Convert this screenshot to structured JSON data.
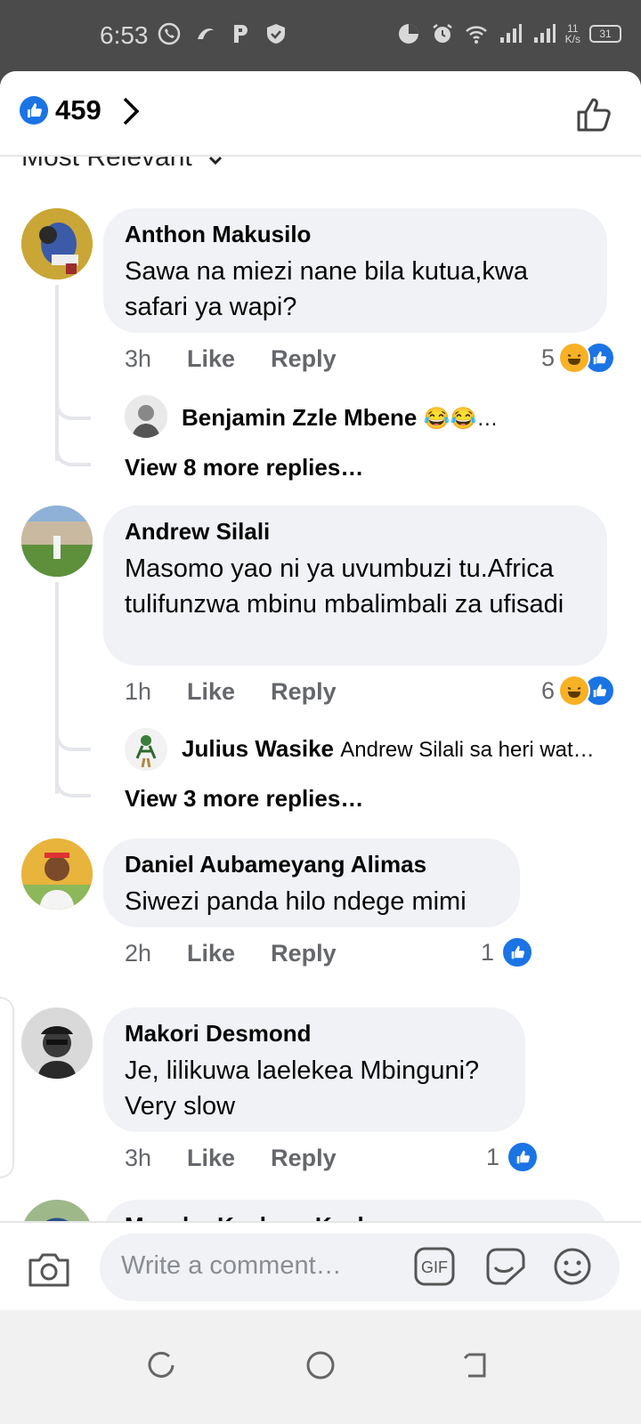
{
  "status_bar": {
    "time": "6:53",
    "net_speed_top": "11",
    "net_speed_unit": "K/s",
    "battery": "31"
  },
  "header": {
    "like_count": "459"
  },
  "sort": {
    "label": "Most Relevant"
  },
  "comments": [
    {
      "name": "Anthon Makusilo",
      "text": "Sawa na miezi nane bila kutua,kwa safari ya wapi?",
      "time": "3h",
      "like": "Like",
      "reply": "Reply",
      "reactions": "5",
      "reply_preview_name": "Benjamin Zzle Mbene",
      "reply_preview_text": "😂😂…",
      "view_more": "View 8 more replies…"
    },
    {
      "name": "Andrew Silali",
      "text": "Masomo yao ni ya uvumbuzi tu.Africa tulifunzwa mbinu mbalimbali za ufisadi",
      "time": "1h",
      "like": "Like",
      "reply": "Reply",
      "reactions": "6",
      "reply_preview_name": "Julius Wasike",
      "reply_preview_text": "Andrew Silali  sa heri wat…",
      "view_more": "View 3 more replies…"
    },
    {
      "name": "Daniel Aubameyang Alimas",
      "text": "Siwezi panda hilo ndege mimi",
      "time": "2h",
      "like": "Like",
      "reply": "Reply",
      "reactions": "1"
    },
    {
      "name": "Makori Desmond",
      "text": "Je, lilikuwa laelekea Mbinguni? Very slow",
      "time": "3h",
      "like": "Like",
      "reply": "Reply",
      "reactions": "1"
    },
    {
      "name": "Msechu Kachara Kachara"
    }
  ],
  "composer": {
    "placeholder": "Write a comment…",
    "gif_label": "GIF"
  },
  "colors": {
    "accent": "#1b74e4",
    "bubble": "#f0f2f5",
    "haha": "#f7b125"
  }
}
